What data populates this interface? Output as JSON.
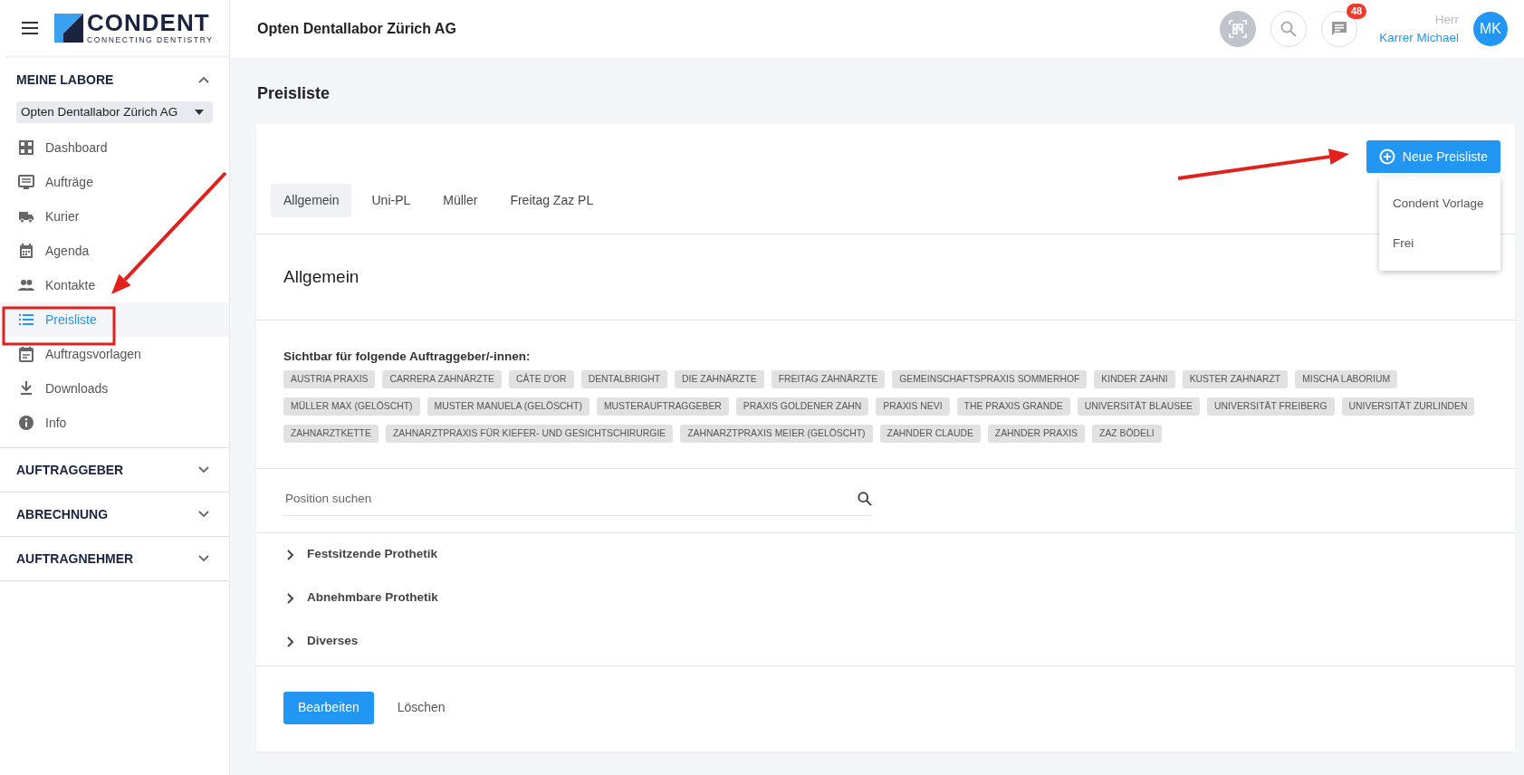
{
  "logo": {
    "name": "CONDENT",
    "tagline": "CONNECTING DENTISTRY"
  },
  "header": {
    "lab_name": "Opten Dentallabor Zürich AG",
    "notification_count": "48",
    "salutation": "Herr",
    "user_name": "Karrer Michael",
    "avatar_initials": "MK"
  },
  "sidebar": {
    "sections": [
      {
        "title": "MEINE LABORE",
        "expanded": true,
        "lab_select": "Opten Dentallabor Zürich AG",
        "items": [
          {
            "label": "Dashboard",
            "selected": false
          },
          {
            "label": "Aufträge",
            "selected": false
          },
          {
            "label": "Kurier",
            "selected": false
          },
          {
            "label": "Agenda",
            "selected": false
          },
          {
            "label": "Kontakte",
            "selected": false
          },
          {
            "label": "Preisliste",
            "selected": true
          },
          {
            "label": "Auftragsvorlagen",
            "selected": false
          },
          {
            "label": "Downloads",
            "selected": false
          },
          {
            "label": "Info",
            "selected": false
          }
        ]
      },
      {
        "title": "AUFTRAGGEBER",
        "expanded": false
      },
      {
        "title": "ABRECHNUNG",
        "expanded": false
      },
      {
        "title": "AUFTRAGNEHMER",
        "expanded": false
      }
    ]
  },
  "page_title": "Preisliste",
  "new_button": {
    "label": "Neue Preisliste",
    "menu_open": true,
    "menu": [
      "Condent Vorlage",
      "Frei"
    ]
  },
  "tabs": [
    {
      "label": "Allgemein",
      "selected": true
    },
    {
      "label": "Uni-PL",
      "selected": false
    },
    {
      "label": "Müller",
      "selected": false
    },
    {
      "label": "Freitag Zaz PL",
      "selected": false
    }
  ],
  "section_title": "Allgemein",
  "visibility_label": "Sichtbar für folgende Auftraggeber/-innen:",
  "clients": [
    "AUSTRIA PRAXIS",
    "CARRERA ZAHNÄRZTE",
    "CÂTE D'OR",
    "DENTALBRIGHT",
    "DIE ZAHNÄRZTE",
    "FREITAG ZAHNÄRZTE",
    "GEMEINSCHAFTSPRAXIS SOMMERHOF",
    "KINDER ZAHNI",
    "KUSTER ZAHNARZT",
    "MISCHA LABORIUM",
    "MÜLLER MAX (GELÖSCHT)",
    "MUSTER MANUELA (GELÖSCHT)",
    "MUSTERAUFTRAGGEBER",
    "PRAXIS GOLDENER ZAHN",
    "PRAXIS NEVI",
    "THE PRAXIS GRANDE",
    "UNIVERSITÄT BLAUSEE",
    "UNIVERSITÄT FREIBERG",
    "UNIVERSITÄT ZURLINDEN",
    "ZAHNARZTKETTE",
    "ZAHNARZTPRAXIS FÜR KIEFER- UND GESICHTSCHIRURGIE",
    "ZAHNARZTPRAXIS MEIER (GELÖSCHT)",
    "ZAHNDER CLAUDE",
    "ZAHNDER PRAXIS",
    "ZAZ BÖDELI"
  ],
  "search": {
    "placeholder": "Position suchen"
  },
  "groups": [
    {
      "label": "Festsitzende Prothetik",
      "expanded": false
    },
    {
      "label": "Abnehmbare Prothetik",
      "expanded": false
    },
    {
      "label": "Diverses",
      "expanded": false
    }
  ],
  "actions": [
    {
      "label": "Bearbeiten",
      "kind": "primary"
    },
    {
      "label": "Löschen",
      "kind": "text"
    }
  ],
  "markup": [
    {
      "kind": "arrow"
    },
    {
      "kind": "frame"
    },
    {
      "kind": "arrow"
    }
  ]
}
